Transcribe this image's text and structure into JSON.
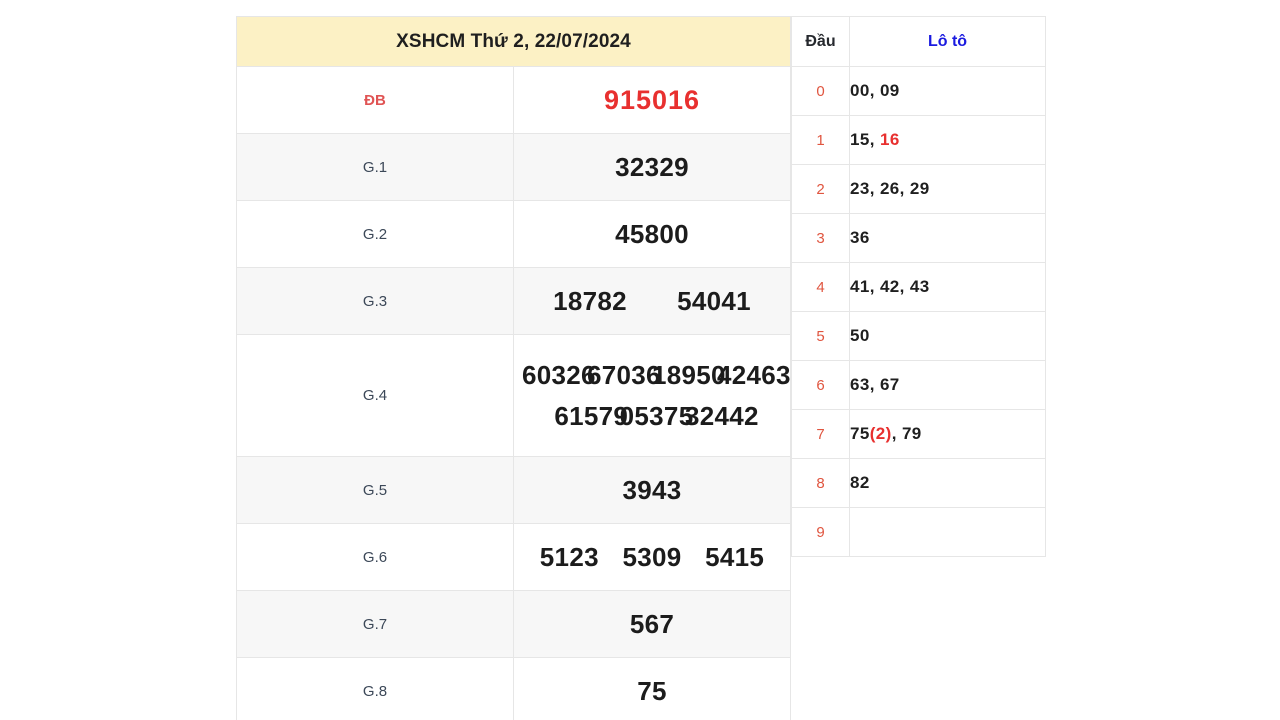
{
  "results": {
    "title": "XSHCM Thứ 2, 22/07/2024",
    "rows": [
      {
        "label": "ĐB",
        "numbers": [
          "915016"
        ],
        "columns": 1,
        "highlight": true,
        "shade": false
      },
      {
        "label": "G.1",
        "numbers": [
          "32329"
        ],
        "columns": 1,
        "highlight": false,
        "shade": true
      },
      {
        "label": "G.2",
        "numbers": [
          "45800"
        ],
        "columns": 1,
        "highlight": false,
        "shade": false
      },
      {
        "label": "G.3",
        "numbers": [
          "18782",
          "54041"
        ],
        "columns": 2,
        "highlight": false,
        "shade": true
      },
      {
        "label": "G.4",
        "numbers": [
          "60326",
          "67036",
          "18950",
          "42463",
          "61579",
          "05375",
          "32442"
        ],
        "columns": 4,
        "highlight": false,
        "shade": false
      },
      {
        "label": "G.5",
        "numbers": [
          "3943"
        ],
        "columns": 1,
        "highlight": false,
        "shade": true
      },
      {
        "label": "G.6",
        "numbers": [
          "5123",
          "5309",
          "5415"
        ],
        "columns": 3,
        "highlight": false,
        "shade": false
      },
      {
        "label": "G.7",
        "numbers": [
          "567"
        ],
        "columns": 1,
        "highlight": false,
        "shade": true
      },
      {
        "label": "G.8",
        "numbers": [
          "75"
        ],
        "columns": 1,
        "highlight": false,
        "shade": false
      }
    ]
  },
  "loto": {
    "header": {
      "dau": "Đầu",
      "loto": "Lô tô"
    },
    "rows": [
      {
        "dau": "0",
        "values": "00, 09",
        "plain": "00, 09"
      },
      {
        "dau": "1",
        "values": "15, 16",
        "plain": "15, 16",
        "repeat_token": "16"
      },
      {
        "dau": "2",
        "values": "23, 26, 29",
        "plain": "23, 26, 29"
      },
      {
        "dau": "3",
        "values": "36",
        "plain": "36"
      },
      {
        "dau": "4",
        "values": "41, 42, 43",
        "plain": "41, 42, 43"
      },
      {
        "dau": "5",
        "values": "50",
        "plain": "50"
      },
      {
        "dau": "6",
        "values": "63, 67",
        "plain": "63, 67"
      },
      {
        "dau": "7",
        "values": "75(2), 79",
        "plain": "75(2), 79",
        "repeat_token": "(2)"
      },
      {
        "dau": "8",
        "values": "82",
        "plain": "82"
      },
      {
        "dau": "9",
        "values": "",
        "plain": ""
      }
    ]
  },
  "colors": {
    "header_bg": "#fcf1c5",
    "special_prize": "#e8302f",
    "loto_header": "#1a1ae0",
    "dau_digit": "#e0553f",
    "row_shade": "#f7f7f7",
    "border": "#e6e6e6"
  }
}
